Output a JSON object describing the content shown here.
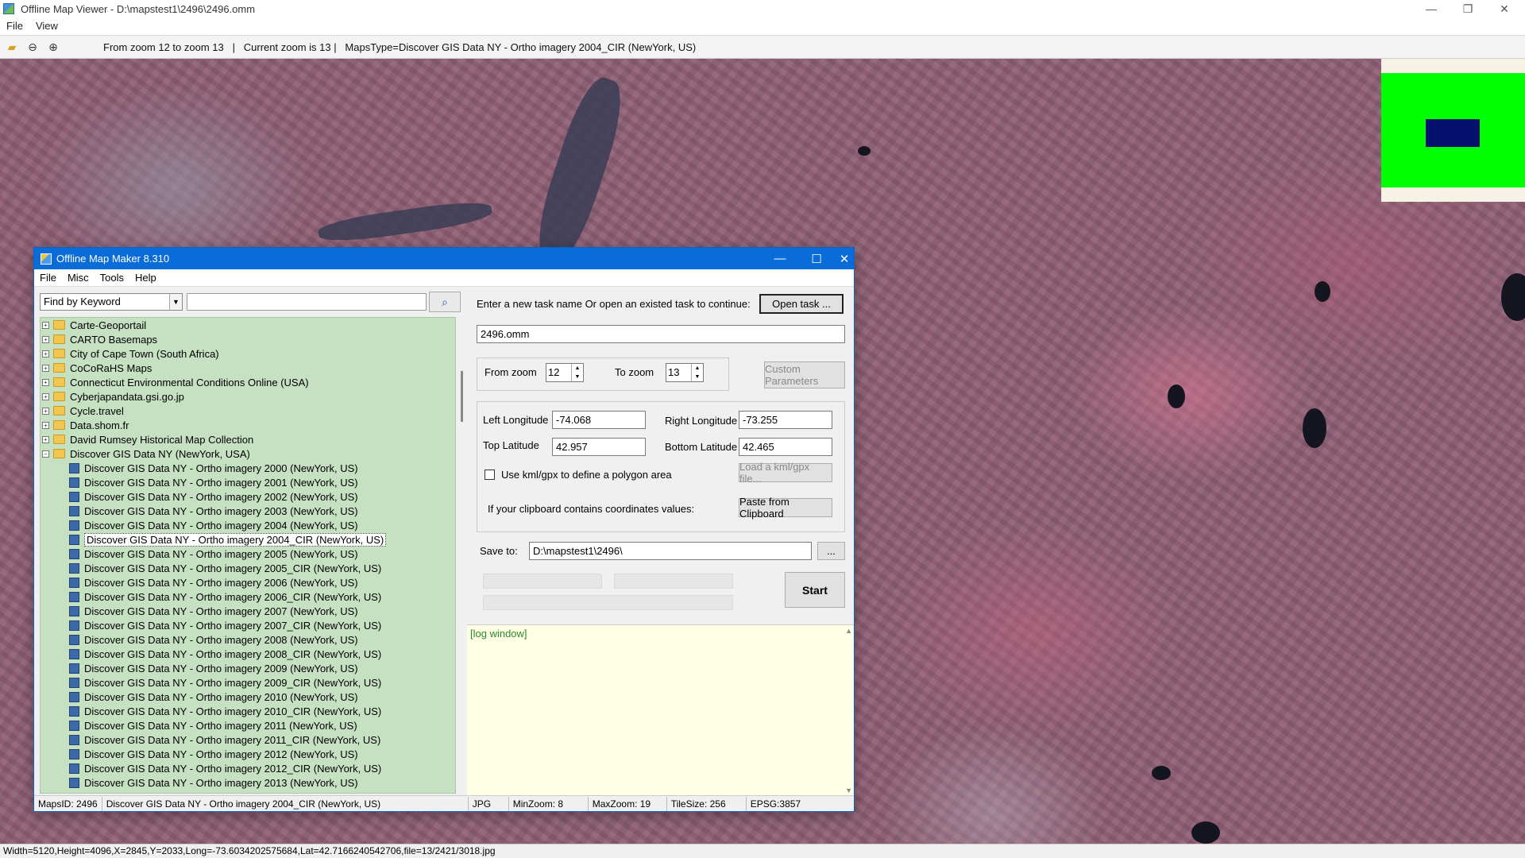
{
  "window": {
    "title": "Offline Map Viewer - D:\\mapstest1\\2496\\2496.omm",
    "menu": [
      "File",
      "View"
    ],
    "controls": {
      "minimize": "—",
      "restore": "❐",
      "close": "✕"
    }
  },
  "toolbar": {
    "info": "From zoom 12 to zoom 13   |   Current zoom is 13 |   MapsType=Discover GIS Data NY - Ortho imagery 2004_CIR (NewYork, US)"
  },
  "statusbar": {
    "text": "Width=5120,Height=4096,X=2845,Y=2033,Long=-73.6034202575684,Lat=42.7166240542706,file=13/2421/3018.jpg"
  },
  "dialog": {
    "title": "Offline Map Maker 8.310",
    "controls": {
      "minimize": "—",
      "maximize": "☐",
      "close": "✕"
    },
    "menu": [
      "File",
      "Misc",
      "Tools",
      "Help"
    ],
    "search": {
      "mode": "Find by Keyword",
      "value": ""
    },
    "tree": {
      "folders": [
        "Carte-Geoportail",
        "CARTO Basemaps",
        "City of Cape Town (South Africa)",
        "CoCoRaHS Maps",
        "Connecticut Environmental Conditions Online (USA)",
        "Cyberjapandata.gsi.go.jp",
        "Cycle.travel",
        "Data.shom.fr",
        "David Rumsey Historical Map Collection"
      ],
      "expanded_folder": "Discover GIS Data NY (NewYork, USA)",
      "items": [
        "Discover GIS Data NY - Ortho imagery 2000 (NewYork, US)",
        "Discover GIS Data NY - Ortho imagery 2001 (NewYork, US)",
        "Discover GIS Data NY - Ortho imagery 2002 (NewYork, US)",
        "Discover GIS Data NY - Ortho imagery 2003 (NewYork, US)",
        "Discover GIS Data NY - Ortho imagery 2004 (NewYork, US)",
        "Discover GIS Data NY - Ortho imagery 2004_CIR (NewYork, US)",
        "Discover GIS Data NY - Ortho imagery 2005 (NewYork, US)",
        "Discover GIS Data NY - Ortho imagery 2005_CIR (NewYork, US)",
        "Discover GIS Data NY - Ortho imagery 2006 (NewYork, US)",
        "Discover GIS Data NY - Ortho imagery 2006_CIR (NewYork, US)",
        "Discover GIS Data NY - Ortho imagery 2007 (NewYork, US)",
        "Discover GIS Data NY - Ortho imagery 2007_CIR (NewYork, US)",
        "Discover GIS Data NY - Ortho imagery 2008 (NewYork, US)",
        "Discover GIS Data NY - Ortho imagery 2008_CIR (NewYork, US)",
        "Discover GIS Data NY - Ortho imagery 2009 (NewYork, US)",
        "Discover GIS Data NY - Ortho imagery 2009_CIR (NewYork, US)",
        "Discover GIS Data NY - Ortho imagery 2010 (NewYork, US)",
        "Discover GIS Data NY - Ortho imagery 2010_CIR (NewYork, US)",
        "Discover GIS Data NY - Ortho imagery 2011 (NewYork, US)",
        "Discover GIS Data NY - Ortho imagery 2011_CIR (NewYork, US)",
        "Discover GIS Data NY - Ortho imagery 2012 (NewYork, US)",
        "Discover GIS Data NY - Ortho imagery 2012_CIR (NewYork, US)",
        "Discover GIS Data NY - Ortho imagery 2013 (NewYork, US)"
      ],
      "selected_item": "Discover GIS Data NY - Ortho imagery 2004_CIR (NewYork, US)"
    },
    "task": {
      "prompt": "Enter a new task name Or open an existed task to continue:",
      "open_button": "Open task ...",
      "name": "2496.omm"
    },
    "zoom": {
      "from_label": "From zoom",
      "from_value": "12",
      "to_label": "To zoom",
      "to_value": "13",
      "custom_button": "Custom Parameters"
    },
    "bounds": {
      "left_label": "Left Longitude",
      "left_value": "-74.068",
      "right_label": "Right Longitude",
      "right_value": "-73.255",
      "top_label": "Top Latitude",
      "top_value": "42.957",
      "bottom_label": "Bottom Latitude",
      "bottom_value": "42.465",
      "kml_label": "Use kml/gpx to define a polygon area",
      "kml_checked": false,
      "kml_button": "Load a kml/gpx file...",
      "clipboard_label": "If your clipboard contains coordinates values:",
      "clipboard_button": "Paste from Clipboard"
    },
    "save": {
      "label": "Save to:",
      "path": "D:\\mapstest1\\2496\\",
      "browse_button": "...",
      "start_button": "Start"
    },
    "log": {
      "text": "[log window]"
    },
    "status": {
      "maps_id": "MapsID: 2496",
      "maps_name": "Discover GIS Data NY - Ortho imagery 2004_CIR (NewYork, US)",
      "format": "JPG",
      "min_zoom": "MinZoom: 8",
      "max_zoom": "MaxZoom: 19",
      "tile_size": "TileSize: 256",
      "epsg": "EPSG:3857"
    }
  },
  "colors": {
    "dialog_title": "#0a6cd8",
    "tree_bg": "#c6e0c2",
    "log_bg": "#ffffe6",
    "overview_green": "#00ff00",
    "overview_blue": "#05116e"
  }
}
